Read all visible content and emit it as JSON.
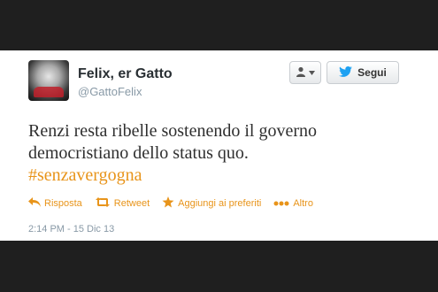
{
  "tweet_card": {
    "user": {
      "name": "Felix, er Gatto",
      "handle": "@GattoFelix"
    },
    "buttons": {
      "follow_label": "Segui"
    },
    "text_main": "Renzi resta ribelle sostenendo il governo democristiano dello status quo.",
    "hashtag": "#senzavergogna",
    "actions": {
      "reply": "Risposta",
      "retweet": "Retweet",
      "favorite": "Aggiungi ai preferiti",
      "more": "Altro"
    },
    "timestamp": "2:14 PM - 15 Dic 13"
  },
  "colors": {
    "accent": "#e8941a",
    "twitter_blue": "#1da1f2",
    "name_text": "#292f33",
    "muted_text": "#8899a6",
    "background_frame": "#1f1f1f"
  },
  "icons": [
    "user-icon",
    "twitter-bird-icon",
    "reply-icon",
    "retweet-icon",
    "star-icon",
    "more-icon"
  ]
}
